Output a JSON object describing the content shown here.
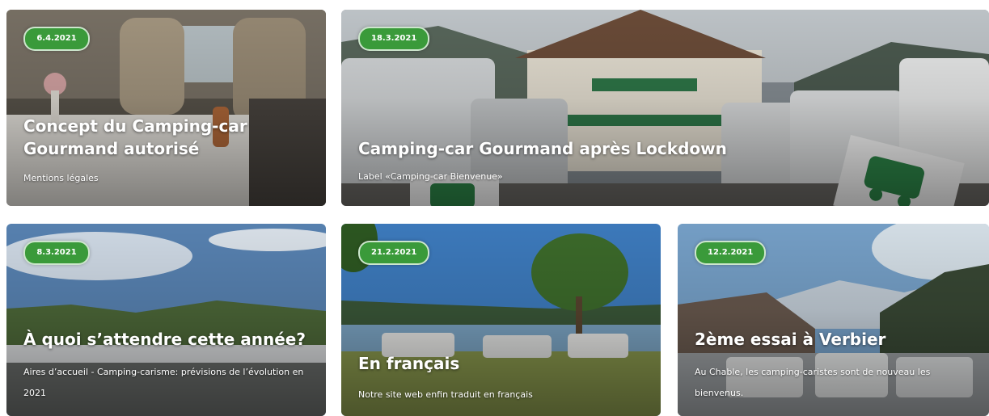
{
  "colors": {
    "badge": "#3a9a3a",
    "text": "#ffffff"
  },
  "cards": [
    {
      "date": "6.4.2021",
      "title": "Concept du Camping-car Gourmand autorisé",
      "subtitle": "Mentions légales"
    },
    {
      "date": "18.3.2021",
      "title": "Camping-car Gourmand après Lockdown",
      "subtitle": "Label «Camping-car Bienvenue»"
    },
    {
      "date": "8.3.2021",
      "title": "À quoi s’attendre cette année?",
      "subtitle": "Aires d’accueil - Camping-carisme: prévisions de l’évolution en 2021"
    },
    {
      "date": "21.2.2021",
      "title": "En français",
      "subtitle": "Notre site web enfin traduit en français"
    },
    {
      "date": "12.2.2021",
      "title": "2ème essai à Verbier",
      "subtitle": "Au Chable, les camping-caristes sont de nouveau les bienvenus."
    }
  ]
}
